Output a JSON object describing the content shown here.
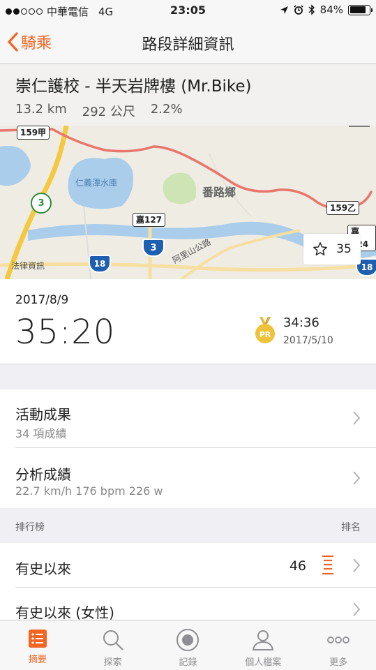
{
  "status": {
    "carrier": "中華電信",
    "network": "4G",
    "time": "23:05",
    "battery": "84%",
    "battery_level": 0.84
  },
  "nav": {
    "back_label": "騎乘",
    "title": "路段詳細資訊"
  },
  "segment": {
    "name": "崇仁護校 - 半天岩牌樓 (Mr.Bike)",
    "distance": "13.2 km",
    "elevation": "292 公尺",
    "grade": "2.2%"
  },
  "map": {
    "labels": {
      "road_159jia": "159甲",
      "road_159yi": "159乙",
      "road_jia127": "嘉127",
      "road_jia124": "嘉124",
      "reservoir": "仁義潭水庫",
      "township": "番路鄉",
      "highway": "阿里山公路",
      "law_bldg": "法律資訊",
      "shield_3a": "3",
      "shield_3b": "3",
      "shield_18a": "18",
      "shield_18b": "18"
    },
    "star_count": "35",
    "colors": {
      "route": "#e8766d",
      "water": "#a9cdea",
      "park": "#cfe4b5",
      "highway": "#f5c842"
    }
  },
  "effort": {
    "date": "2017/8/9",
    "time": "35:20",
    "pr_badge": "PR",
    "pr_time": "34:36",
    "pr_date": "2017/5/10"
  },
  "rows": {
    "achievements_title": "活動成果",
    "achievements_sub": "34 項成績",
    "analysis_title": "分析成績",
    "analysis_sub": "22.7 km/h 176 bpm 226 w"
  },
  "leaderboard": {
    "header": "排行榜",
    "rank_header": "排名",
    "all_time_label": "有史以來",
    "all_time_rank": "46",
    "all_time_women_label": "有史以來 (女性)"
  },
  "tabs": [
    {
      "label": "摘要",
      "icon": "list-icon"
    },
    {
      "label": "探索",
      "icon": "search-icon"
    },
    {
      "label": "記錄",
      "icon": "record-icon"
    },
    {
      "label": "個人檔案",
      "icon": "profile-icon"
    },
    {
      "label": "更多",
      "icon": "more-icon"
    }
  ],
  "accent_color": "#f26522"
}
